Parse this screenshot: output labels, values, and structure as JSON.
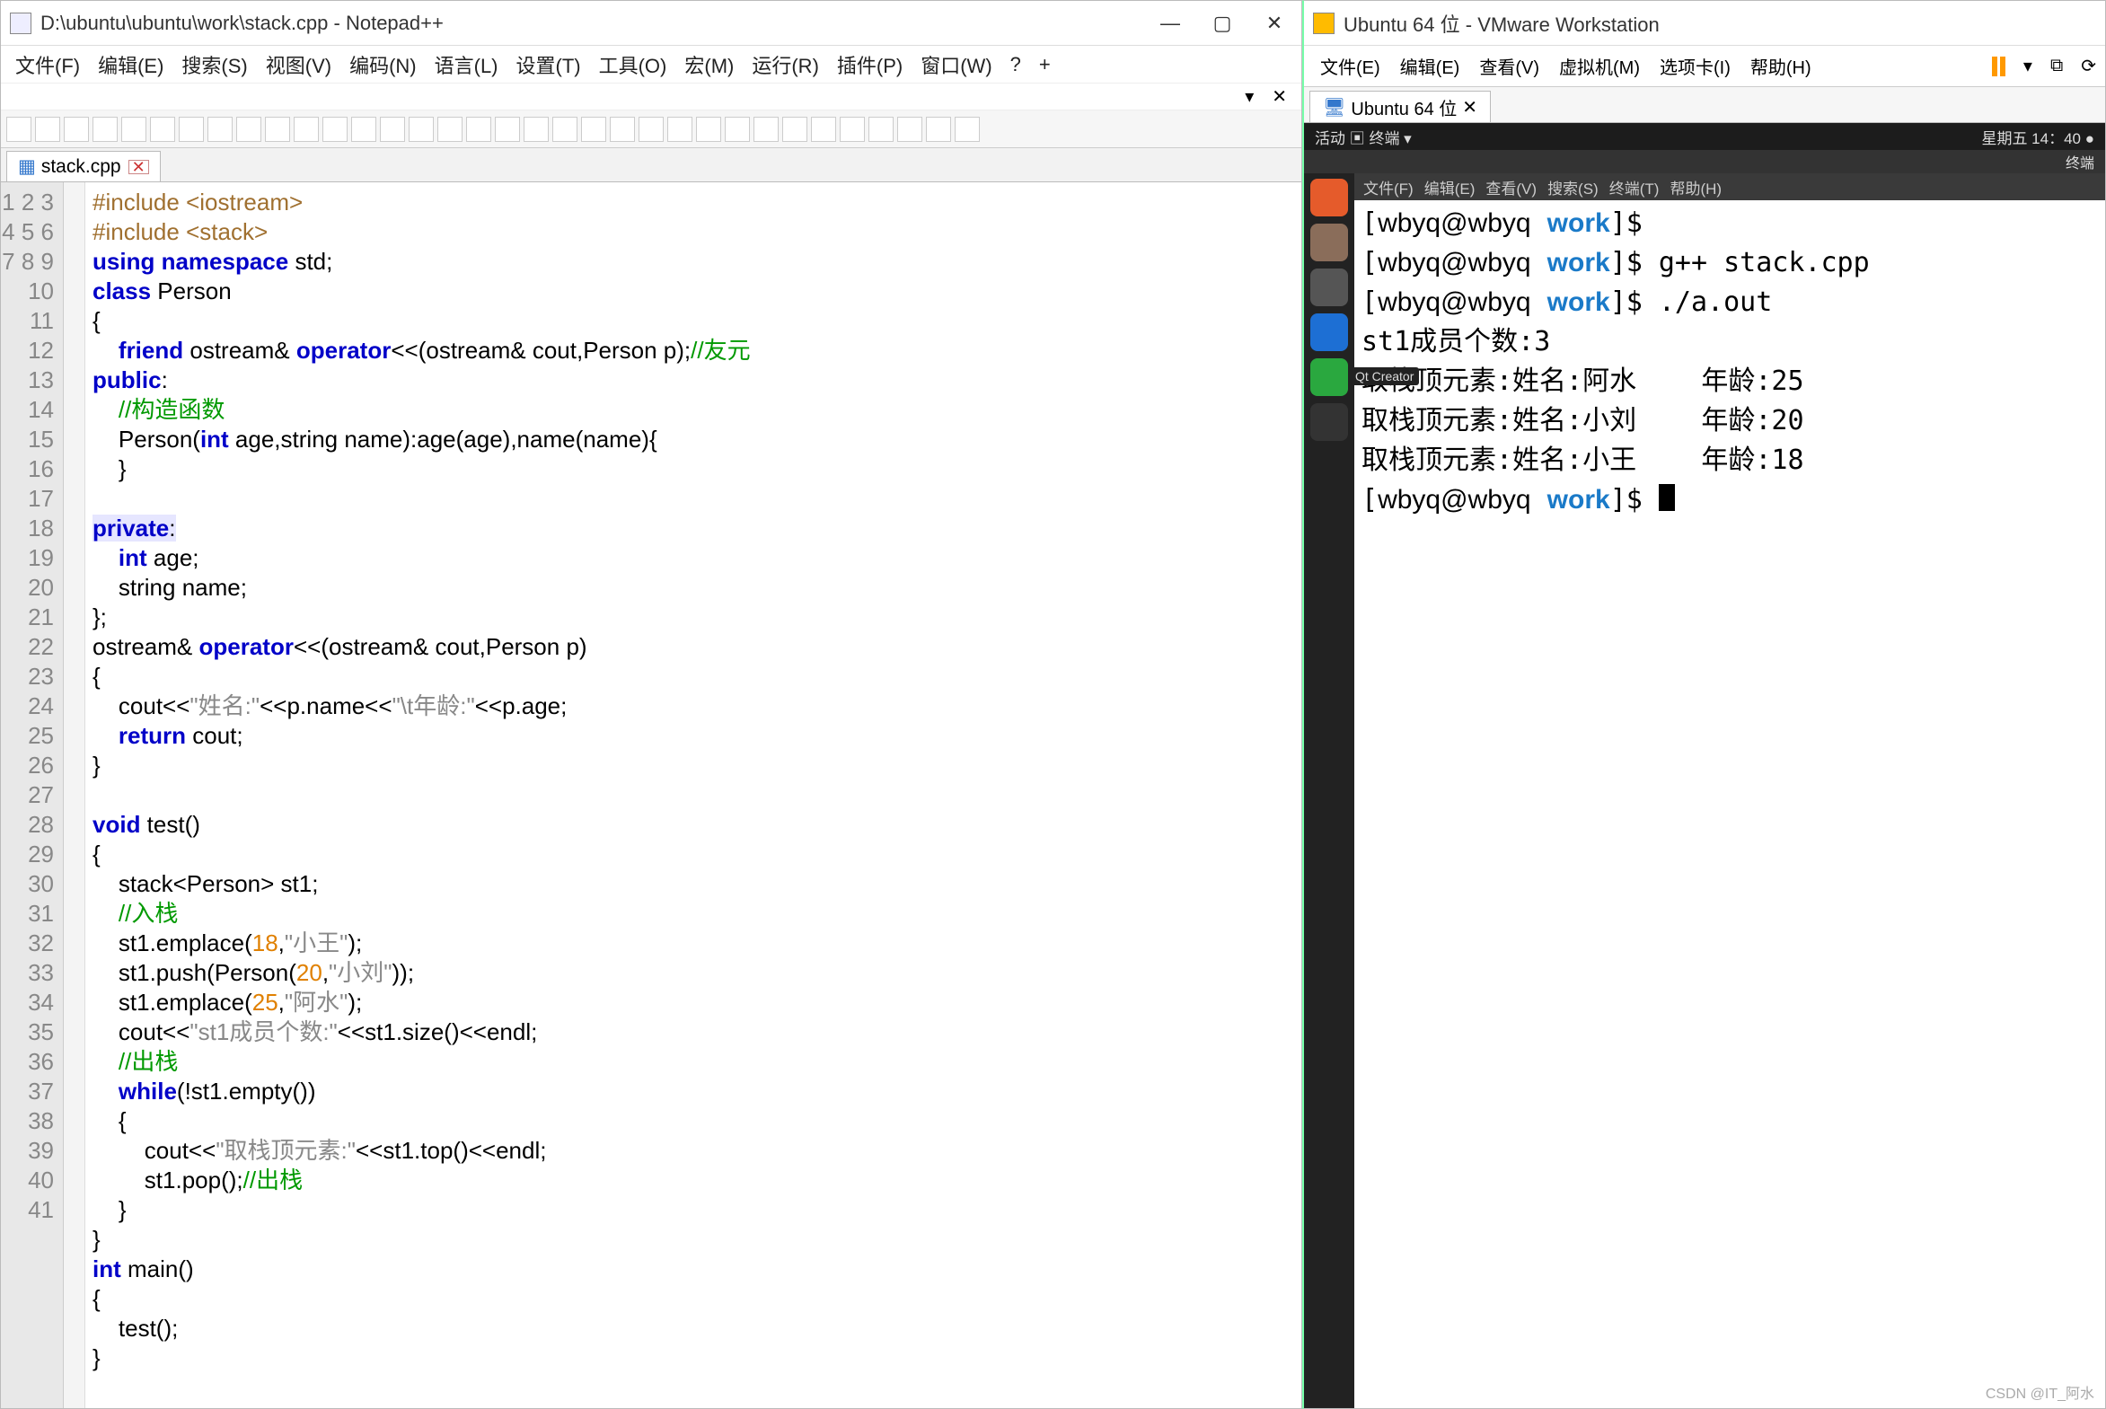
{
  "notepad": {
    "title": "D:\\ubuntu\\ubuntu\\work\\stack.cpp - Notepad++",
    "menus": [
      "文件(F)",
      "编辑(E)",
      "搜索(S)",
      "视图(V)",
      "编码(N)",
      "语言(L)",
      "设置(T)",
      "工具(O)",
      "宏(M)",
      "运行(R)",
      "插件(P)",
      "窗口(W)",
      "?",
      "+"
    ],
    "tab": "stack.cpp",
    "lines": 41,
    "code_html": "<span class='pp'>#include</span> <span class='pp'>&lt;iostream&gt;</span>\n<span class='pp'>#include</span> <span class='pp'>&lt;stack&gt;</span>\n<span class='kw'>using</span> <span class='kw'>namespace</span> std;\n<span class='kw'>class</span> Person\n{\n    <span class='kw'>friend</span> ostream&amp; <span class='kw'>operator</span>&lt;&lt;(ostream&amp; cout,Person p);<span class='cm'>//友元</span>\n<span class='kw'>public</span>:\n    <span class='cm'>//构造函数</span>\n    Person(<span class='kw'>int</span> age,string name):age(age),name(name){\n    }\n\n<span class='hl-line'><span class='kw'>private</span>:</span>\n    <span class='kw'>int</span> age;\n    string name;\n};\nostream&amp; <span class='kw'>operator</span>&lt;&lt;(ostream&amp; cout,Person p)\n{\n    cout&lt;&lt;<span class='str'>\"姓名:\"</span>&lt;&lt;p.name&lt;&lt;<span class='str'>\"\\t年龄:\"</span>&lt;&lt;p.age;\n    <span class='kw'>return</span> cout;\n}\n\n<span class='kw'>void</span> test()\n{\n    stack&lt;Person&gt; st1;\n    <span class='cm'>//入栈</span>\n    st1.emplace(<span class='num'>18</span>,<span class='str'>\"小王\"</span>);\n    st1.push(Person(<span class='num'>20</span>,<span class='str'>\"小刘\"</span>));\n    st1.emplace(<span class='num'>25</span>,<span class='str'>\"阿水\"</span>);\n    cout&lt;&lt;<span class='str'>\"st1成员个数:\"</span>&lt;&lt;st1.size()&lt;&lt;endl;\n    <span class='cm'>//出栈</span>\n    <span class='kw'>while</span>(!st1.empty())\n    {\n        cout&lt;&lt;<span class='str'>\"取栈顶元素:\"</span>&lt;&lt;st1.top()&lt;&lt;endl;\n        st1.pop();<span class='cm'>//出栈</span>\n    }\n}\n<span class='kw'>int</span> main()\n{\n    test();\n}\n"
  },
  "vmware": {
    "title": "Ubuntu 64 位 - VMware Workstation",
    "menus": [
      "文件(E)",
      "编辑(E)",
      "查看(V)",
      "虚拟机(M)",
      "选项卡(I)",
      "帮助(H)"
    ],
    "tab": "Ubuntu 64 位",
    "ubuntu_top_left": "活动  ▣ 终端 ▾",
    "ubuntu_top_right": "星期五 14：40 ●",
    "ubuntu_sub_right": "终端",
    "term_menus": [
      "文件(F)",
      "编辑(E)",
      "查看(V)",
      "搜索(S)",
      "终端(T)",
      "帮助(H)"
    ],
    "term_html": "[<span class='prompt-h'>wbyq@wbyq</span> <span class='prompt-w'>work</span>]$\n[<span class='prompt-h'>wbyq@wbyq</span> <span class='prompt-w'>work</span>]$ g++ stack.cpp\n[<span class='prompt-h'>wbyq@wbyq</span> <span class='prompt-w'>work</span>]$ ./a.out\nst1成员个数:3\n取栈顶元素:姓名:阿水    年龄:25\n取栈顶元素:姓名:小刘    年龄:20\n取栈顶元素:姓名:小王    年龄:18\n[<span class='prompt-h'>wbyq@wbyq</span> <span class='prompt-w'>work</span>]$ <span class='cursor'></span>",
    "qt_tooltip": "Qt Creator"
  },
  "watermark": "CSDN @IT_阿水"
}
